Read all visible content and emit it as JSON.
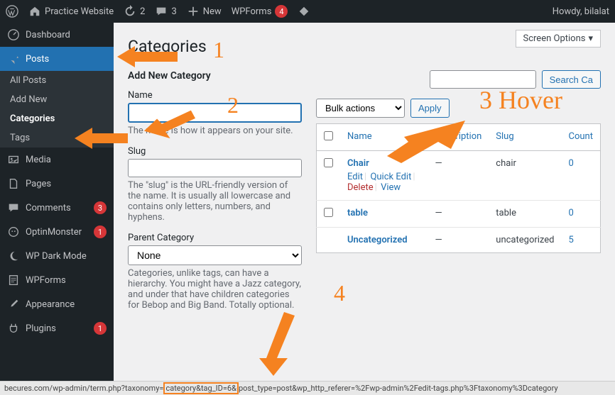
{
  "adminbar": {
    "site_name": "Practice Website",
    "updates": "2",
    "comments": "3",
    "new_label": "New",
    "wpforms_label": "WPForms",
    "wpforms_count": "4",
    "howdy": "Howdy, bilalat"
  },
  "sidebar": {
    "dashboard": "Dashboard",
    "posts": "Posts",
    "posts_sub": {
      "all": "All Posts",
      "add": "Add New",
      "categories": "Categories",
      "tags": "Tags"
    },
    "media": "Media",
    "pages": "Pages",
    "comments": "Comments",
    "comments_count": "3",
    "optinmonster": "OptinMonster",
    "optin_count": "1",
    "wpdark": "WP Dark Mode",
    "wpforms": "WPForms",
    "appearance": "Appearance",
    "plugins": "Plugins",
    "plugins_count": "1"
  },
  "screen_options": "Screen Options",
  "page_title": "Categories",
  "form": {
    "heading": "Add New Category",
    "name_label": "Name",
    "name_help": "The name is how it appears on your site.",
    "slug_label": "Slug",
    "slug_help": "The \"slug\" is the URL-friendly version of the name. It is usually all lowercase and contains only letters, numbers, and hyphens.",
    "parent_label": "Parent Category",
    "parent_value": "None",
    "parent_help": "Categories, unlike tags, can have a hierarchy. You might have a Jazz category, and under that have children categories for Bebop and Big Band. Totally optional."
  },
  "search": {
    "button": "Search Ca"
  },
  "bulk": {
    "label": "Bulk actions",
    "apply": "Apply"
  },
  "table": {
    "cols": {
      "name": "Name",
      "desc": "Description",
      "slug": "Slug",
      "count": "Count"
    },
    "rows": [
      {
        "name": "Chair",
        "desc": "—",
        "slug": "chair",
        "count": "0",
        "hover": true
      },
      {
        "name": "table",
        "desc": "—",
        "slug": "table",
        "count": "0",
        "hover": false
      },
      {
        "name": "Uncategorized",
        "desc": "—",
        "slug": "uncategorized",
        "count": "5",
        "hover": false
      }
    ],
    "actions": {
      "edit": "Edit",
      "quick": "Quick Edit",
      "delete": "Delete",
      "view": "View"
    }
  },
  "statusbar": {
    "pre": "becures.com/wp-admin/term.php?taxonomy=",
    "hl": "category&tag_ID=6&",
    "post": "post_type=post&wp_http_referer=%2Fwp-admin%2Fedit-tags.php%3Ftaxonomy%3Dcategory"
  },
  "annotations": {
    "n1": "1",
    "n2": "2",
    "n3": "3 Hover",
    "n4": "4"
  }
}
